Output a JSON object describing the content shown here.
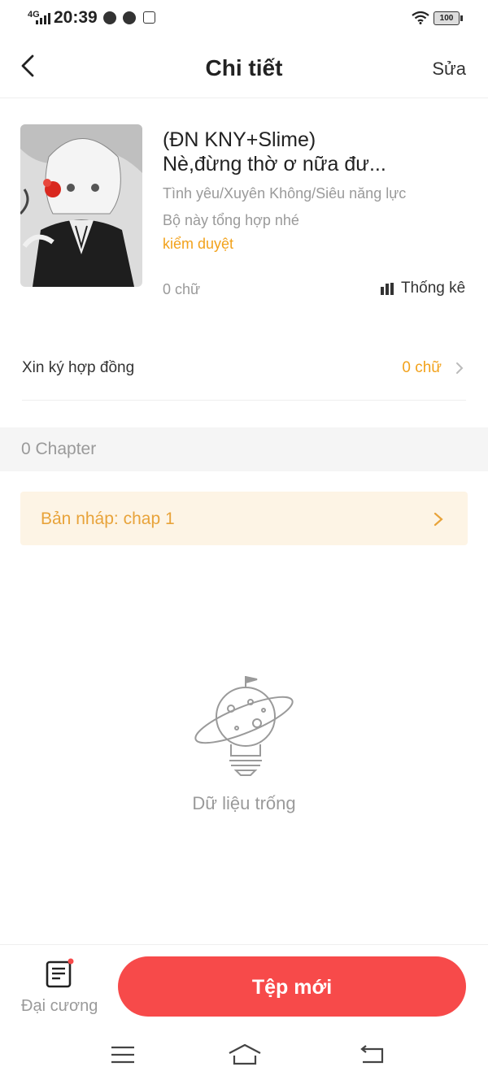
{
  "status_bar": {
    "network": "4G",
    "time": "20:39",
    "battery": "100"
  },
  "header": {
    "title": "Chi tiết",
    "edit_label": "Sửa"
  },
  "book": {
    "title_line1": "(ĐN KNY+Slime)",
    "title_line2": "Nè,đừng thờ ơ nữa đư...",
    "genres": "Tình yêu/Xuyên Không/Siêu năng lực",
    "description": "Bộ này tổng hợp nhé",
    "status": "kiểm duyệt",
    "word_count": "0 chữ",
    "stats_label": "Thống kê"
  },
  "contract": {
    "label": "Xin ký hợp đồng",
    "value": "0 chữ"
  },
  "chapters": {
    "count_label": "0 Chapter"
  },
  "draft": {
    "label": "Bản nháp: chap 1"
  },
  "empty_state": {
    "text": "Dữ liệu trống"
  },
  "bottom_bar": {
    "outline_label": "Đại cương",
    "new_file_label": "Tệp mới"
  },
  "colors": {
    "accent_orange": "#f2a21c",
    "primary_red": "#f74a4a",
    "draft_bg": "#fdf4e5"
  }
}
